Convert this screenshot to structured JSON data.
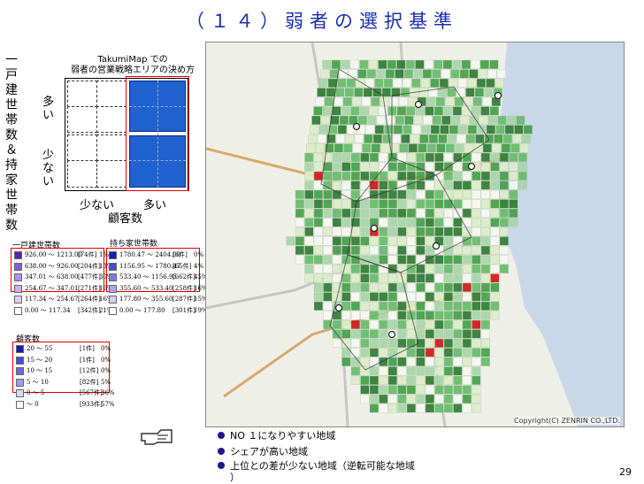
{
  "title": "（１４）弱者の選択基準",
  "left_panel": {
    "caption_line1": "TakumiMap での",
    "caption_line2": "弱者の営業戦略エリアの決め方",
    "vertical_label": "一戸建世帯数＆持家世帯数",
    "y_many": "多い",
    "y_few": "少ない",
    "x_few": "少ない",
    "x_many": "多い",
    "x_axis_label": "顧客数"
  },
  "legend_detached": {
    "title": "一戸建世帯数",
    "rows": [
      {
        "range": "926.00 ～ 1213.00",
        "count": "[74件]",
        "pct": "1%",
        "color": "#5a1fb0"
      },
      {
        "range": "638.00 ～ 926.00",
        "count": "[204件]",
        "pct": "13%",
        "color": "#8a5ad8"
      },
      {
        "range": "347.01 ～ 638.00",
        "count": "[477件]",
        "pct": "30%",
        "color": "#b48ae8"
      },
      {
        "range": "254.67 ～ 347.01",
        "count": "[271件]",
        "pct": "16%",
        "color": "#ccb0f0"
      },
      {
        "range": "117.34 ～ 254.67",
        "count": "[264件]",
        "pct": "16%",
        "color": "#ddd0f4"
      },
      {
        "range": "0.00 ～ 117.34",
        "count": "[342件]",
        "pct": "21%",
        "color": "#ffffff"
      }
    ]
  },
  "legend_owned": {
    "title": "持ち家世帯数",
    "rows": [
      {
        "range": "1780.47 ～ 2404.00",
        "count": "[6件]",
        "pct": "0%",
        "color": "#1a1ab0"
      },
      {
        "range": "1156.95 ～ 1780.47",
        "count": "[65件]",
        "pct": "4%",
        "color": "#4a4ad8"
      },
      {
        "range": "533.40 ～ 1156.95",
        "count": "[662件]",
        "pct": "45%",
        "color": "#7a7ae8"
      },
      {
        "range": "355.60 ～ 533.40",
        "count": "[258件]",
        "pct": "16%",
        "color": "#a8a8f0"
      },
      {
        "range": "177.80 ～ 355.60",
        "count": "[287件]",
        "pct": "15%",
        "color": "#d0d0f8"
      },
      {
        "range": "0.00 ～ 177.80",
        "count": "[301件]",
        "pct": "19%",
        "color": "#ffffff"
      }
    ]
  },
  "legend_customers": {
    "title": "顧客数",
    "rows": [
      {
        "range": "20 ～ 55",
        "count": "[1件]",
        "pct": "0%",
        "color": "#1a1ab0"
      },
      {
        "range": "15 ～ 20",
        "count": "[1件]",
        "pct": "0%",
        "color": "#4a4ad8"
      },
      {
        "range": "10 ～ 15",
        "count": "[12件]",
        "pct": "0%",
        "color": "#6a6ae0"
      },
      {
        "range": "5 ～ 10",
        "count": "[82件]",
        "pct": "5%",
        "color": "#9a9af0"
      },
      {
        "range": "0 ～ 5",
        "count": "[567件]",
        "pct": "36%",
        "color": "#d8d8fa"
      },
      {
        "range": "～ 0",
        "count": "[933件]",
        "pct": "57%",
        "color": "#ffffff"
      }
    ]
  },
  "map": {
    "copyright": "Copyright(C) ZENRIN CO.,LTD."
  },
  "bullets": [
    "NO １になりやすい地域",
    "シェアが高い地域",
    "上位との差が少ない地域（逆転可能な地域",
    "）"
  ],
  "page_number": "29",
  "colors": {
    "title": "#1a2fb0",
    "highlight": "#e00000",
    "matrix_blue": "#1f62d0"
  },
  "icons": [
    "pointing-hand-icon"
  ]
}
